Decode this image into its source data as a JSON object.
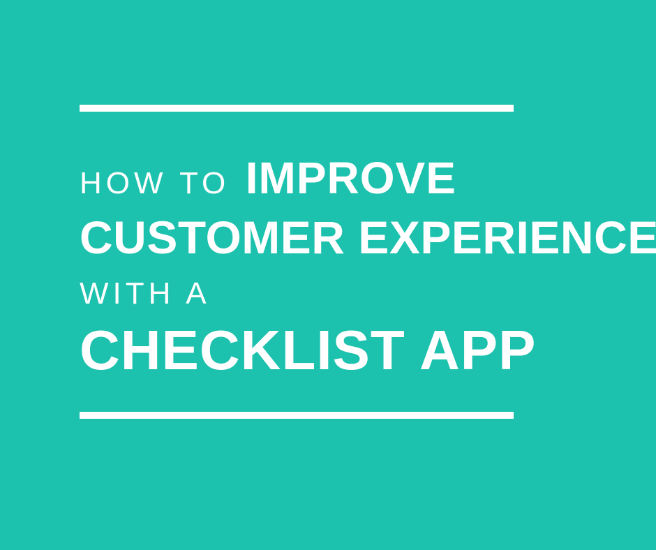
{
  "title": {
    "line1_thin": "How to",
    "line1_bold": "Improve",
    "line2_bold": "Customer Experience",
    "line3_thin": "With a",
    "line4_bold": "Checklist App"
  },
  "colors": {
    "background": "#1cc2ae",
    "text": "#ffffff",
    "rule": "#ffffff"
  }
}
